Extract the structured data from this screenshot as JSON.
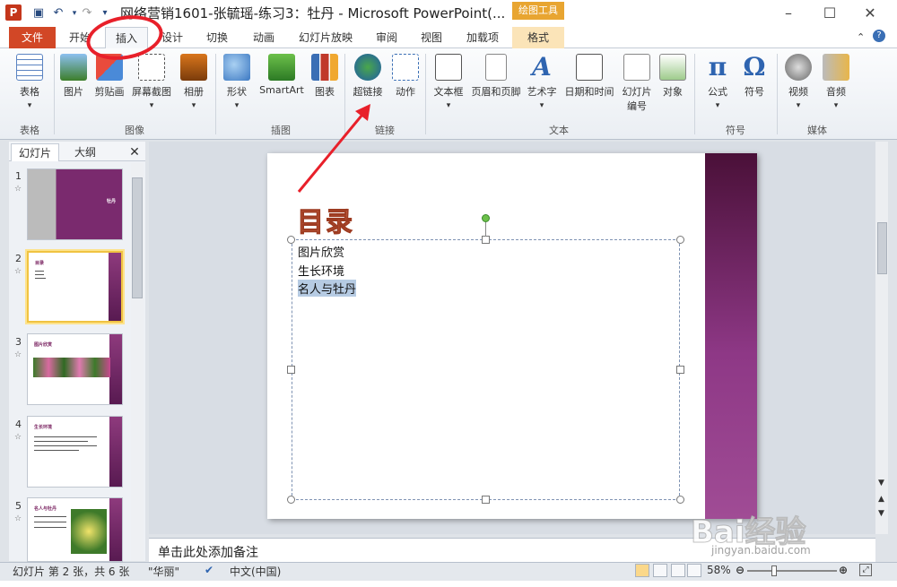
{
  "window": {
    "title": "网络营销1601-张毓瑶-练习3：牡丹  -  Microsoft PowerPoint(...",
    "context_tab": "绘图工具",
    "app_icon": "P"
  },
  "tabs": [
    "文件",
    "开始",
    "插入",
    "设计",
    "切换",
    "动画",
    "幻灯片放映",
    "审阅",
    "视图",
    "加载项",
    "格式"
  ],
  "active_tab": "插入",
  "ribbon": {
    "groups": [
      {
        "label": "表格",
        "buttons": [
          "表格"
        ]
      },
      {
        "label": "图像",
        "buttons": [
          "图片",
          "剪贴画",
          "屏幕截图",
          "相册"
        ]
      },
      {
        "label": "插图",
        "buttons": [
          "形状",
          "SmartArt",
          "图表"
        ]
      },
      {
        "label": "链接",
        "buttons": [
          "超链接",
          "动作"
        ]
      },
      {
        "label": "文本",
        "buttons": [
          "文本框",
          "页眉和页脚",
          "艺术字",
          "日期和时间",
          "幻灯片",
          "编号",
          "对象"
        ]
      },
      {
        "label": "符号",
        "buttons": [
          "公式",
          "符号"
        ]
      },
      {
        "label": "媒体",
        "buttons": [
          "视频",
          "音频"
        ]
      }
    ]
  },
  "pane": {
    "tabs": [
      "幻灯片",
      "大纲"
    ],
    "close": "✕",
    "slides": [
      {
        "num": "1",
        "title": "牡丹"
      },
      {
        "num": "2",
        "title": "目录"
      },
      {
        "num": "3",
        "title": "图片欣赏"
      },
      {
        "num": "4",
        "title": "生长环境"
      },
      {
        "num": "5",
        "title": "名人与牡丹"
      }
    ]
  },
  "slide": {
    "title": "目录",
    "items": [
      "图片欣赏",
      "生长环境",
      "名人与牡丹"
    ]
  },
  "notes": {
    "placeholder": "单击此处添加备注"
  },
  "status": {
    "slide_info": "幻灯片 第 2 张，共 6 张",
    "theme": "\"华丽\"",
    "language": "中文(中国)",
    "zoom": "58%"
  },
  "watermark": {
    "brand": "Bai经验",
    "url": "jingyan.baidu.com"
  },
  "colors": {
    "file_tab": "#d24726",
    "slide_bar": "#8e3886",
    "annotation": "#e8202a",
    "title_text": "#e97f5b"
  }
}
